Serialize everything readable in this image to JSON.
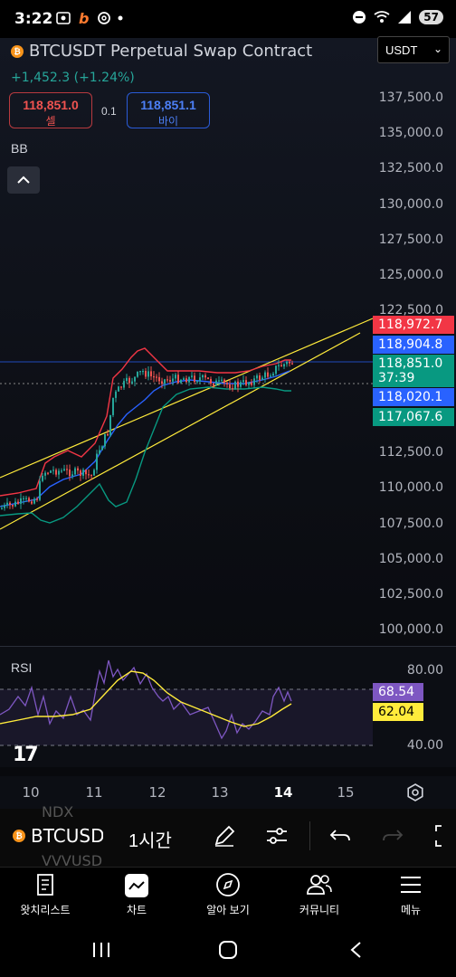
{
  "status": {
    "time": "3:22",
    "battery": "57"
  },
  "header": {
    "symbol_title": "BTCUSDT Perpetual Swap Contract",
    "change": "+1,452.3 (+1.24%)",
    "currency": "USDT"
  },
  "trade": {
    "sell_price": "118,851.0",
    "sell_label": "셀",
    "spread": "0.1",
    "buy_price": "118,851.1",
    "buy_label": "바이"
  },
  "indicators": {
    "main": "BB",
    "sub": "RSI"
  },
  "price_axis": [
    "137,500.0",
    "135,000.0",
    "132,500.0",
    "130,000.0",
    "127,500.0",
    "125,000.0",
    "122,500.0",
    "112,500.0",
    "110,000.0",
    "107,500.0",
    "105,000.0",
    "102,500.0",
    "100,000.0"
  ],
  "price_tags": {
    "upper": "118,972.7",
    "basis": "118,904.8",
    "last": "118,851.0",
    "countdown": "37:39",
    "lower_blue": "118,020.1",
    "lower_green": "117,067.6"
  },
  "rsi_axis": {
    "top": "80.00",
    "bottom": "40.00",
    "rsi_value": "68.54",
    "ma_value": "62.04"
  },
  "time_axis": [
    "10",
    "11",
    "12",
    "13",
    "14",
    "15"
  ],
  "toolbar": {
    "symbol": "BTCUSDT",
    "interval": "1시간",
    "ghost_top": "NDX",
    "ghost_bottom": "VVVUSD"
  },
  "bottom_nav": [
    "왓치리스트",
    "차트",
    "알아 보기",
    "커뮤니티",
    "메뉴"
  ],
  "colors": {
    "up": "#26a69a",
    "down": "#ef5350",
    "blue": "#2962ff",
    "bb_upper": "#f23645",
    "bb_basis": "#2962ff",
    "bb_lower": "#089981",
    "trend": "#ffeb3b",
    "rsi": "#7e57c2"
  }
}
